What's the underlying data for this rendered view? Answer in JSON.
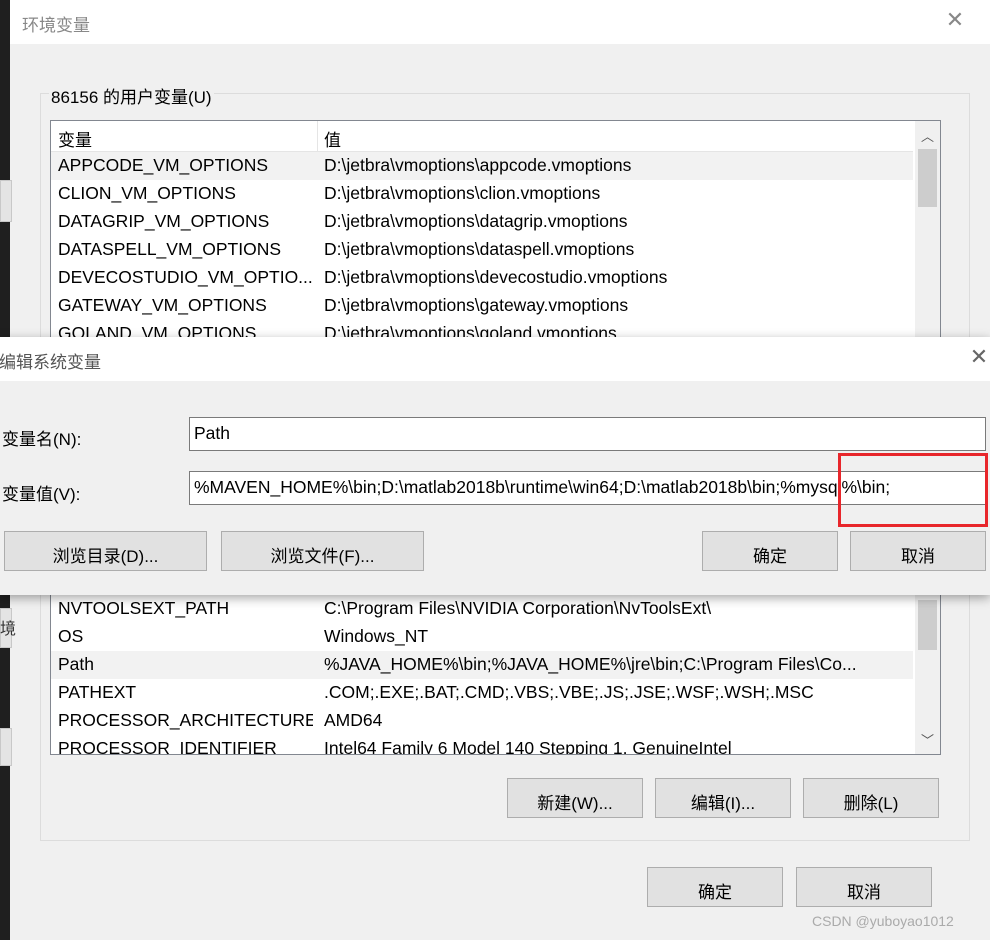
{
  "env_window": {
    "title": "环境变量",
    "user_group_label": "86156 的用户变量(U)",
    "columns": {
      "name": "变量",
      "value": "值"
    },
    "user_vars": [
      {
        "name": "APPCODE_VM_OPTIONS",
        "value": "D:\\jetbra\\vmoptions\\appcode.vmoptions"
      },
      {
        "name": "CLION_VM_OPTIONS",
        "value": "D:\\jetbra\\vmoptions\\clion.vmoptions"
      },
      {
        "name": "DATAGRIP_VM_OPTIONS",
        "value": "D:\\jetbra\\vmoptions\\datagrip.vmoptions"
      },
      {
        "name": "DATASPELL_VM_OPTIONS",
        "value": "D:\\jetbra\\vmoptions\\dataspell.vmoptions"
      },
      {
        "name": "DEVECOSTUDIO_VM_OPTIO...",
        "value": "D:\\jetbra\\vmoptions\\devecostudio.vmoptions"
      },
      {
        "name": "GATEWAY_VM_OPTIONS",
        "value": "D:\\jetbra\\vmoptions\\gateway.vmoptions"
      },
      {
        "name": "GOLAND_VM_OPTIONS",
        "value": "D:\\jetbra\\vmoptions\\goland.vmoptions"
      }
    ],
    "system_vars": [
      {
        "name": "NVTOOLSEXT_PATH",
        "value": "C:\\Program Files\\NVIDIA Corporation\\NvToolsExt\\"
      },
      {
        "name": "OS",
        "value": "Windows_NT"
      },
      {
        "name": "Path",
        "value": "%JAVA_HOME%\\bin;%JAVA_HOME%\\jre\\bin;C:\\Program Files\\Co..."
      },
      {
        "name": "PATHEXT",
        "value": ".COM;.EXE;.BAT;.CMD;.VBS;.VBE;.JS;.JSE;.WSF;.WSH;.MSC"
      },
      {
        "name": "PROCESSOR_ARCHITECTURE",
        "value": "AMD64"
      },
      {
        "name": "PROCESSOR_IDENTIFIER",
        "value": "Intel64 Family 6 Model 140 Stepping 1, GenuineIntel"
      }
    ],
    "sys_buttons": {
      "new": "新建(W)...",
      "edit": "编辑(I)...",
      "delete": "删除(L)"
    },
    "footer_buttons": {
      "ok": "确定",
      "cancel": "取消"
    },
    "partial_left_text": "境"
  },
  "edit_dialog": {
    "title": "编辑系统变量",
    "name_label": "变量名(N):",
    "name_value": "Path",
    "value_label": "变量值(V):",
    "value_value": "%MAVEN_HOME%\\bin;D:\\matlab2018b\\runtime\\win64;D:\\matlab2018b\\bin;%mysql%\\bin;",
    "buttons": {
      "browse_dir": "浏览目录(D)...",
      "browse_file": "浏览文件(F)...",
      "ok": "确定",
      "cancel": "取消"
    }
  },
  "watermark": "CSDN @yuboyao1012",
  "colors": {
    "highlight": "#e8262b",
    "window_bg": "#f0f0f0"
  },
  "icons": {
    "close": "close-icon",
    "scroll_up": "chevron-up-icon",
    "scroll_down": "chevron-down-icon"
  }
}
